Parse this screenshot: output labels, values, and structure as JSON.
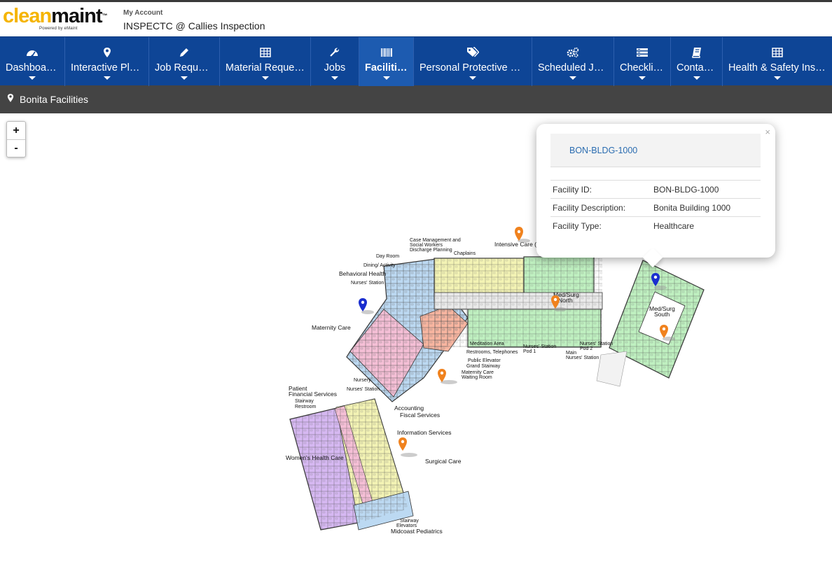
{
  "header": {
    "logo_word_a": "clean",
    "logo_word_b": "maint",
    "logo_tm": "™",
    "logo_sub": "Powered by eMaint",
    "account_label": "My Account",
    "account_name": "INSPECTC @ Callies Inspection"
  },
  "nav": {
    "items": [
      {
        "label": "Dashboards",
        "icon": "dashboard-icon"
      },
      {
        "label": "Interactive Plans",
        "icon": "map-pin-icon"
      },
      {
        "label": "Job Requests",
        "icon": "pencil-icon"
      },
      {
        "label": "Material Requests",
        "icon": "grid-icon"
      },
      {
        "label": "Jobs",
        "icon": "wrench-icon"
      },
      {
        "label": "Facilities",
        "icon": "barcode-icon",
        "active": true
      },
      {
        "label": "Personal Protective Eq...",
        "icon": "tags-icon"
      },
      {
        "label": "Scheduled Jobs",
        "icon": "gears-icon"
      },
      {
        "label": "Checklists",
        "icon": "list-icon"
      },
      {
        "label": "Contacts",
        "icon": "book-icon"
      },
      {
        "label": "Health & Safety Inspe...",
        "icon": "grid-icon"
      }
    ]
  },
  "subbar": {
    "title": "Bonita Facilities"
  },
  "zoom": {
    "in": "+",
    "out": "-"
  },
  "popup": {
    "close": "×",
    "heading": "BON-BLDG-1000",
    "rows": [
      {
        "key": "Facility ID:",
        "value": "BON-BLDG-1000"
      },
      {
        "key": "Facility Description:",
        "value": "Bonita Building 1000"
      },
      {
        "key": "Facility Type:",
        "value": "Healthcare"
      }
    ]
  },
  "plan_labels": {
    "case_mgmt_1": "Case Management and",
    "case_mgmt_2": "Social Workers",
    "case_mgmt_3": "Discharge Planning",
    "chaplains": "Chaplains",
    "intensive_care": "Intensive Care (",
    "day_room": "Day Room",
    "dining": "Dining/ Activity",
    "behavioral": "Behavioral Health",
    "nurses_station_1": "Nurses' Station",
    "maternity_care": "Maternity Care",
    "meditation": "Meditation Area",
    "restrooms": "Restrooms, Telephones",
    "public_elevator": "Public Elevator",
    "grand_stairway": "Grand Stairway",
    "maternity_wait_1": "Maternity Care",
    "maternity_wait_2": "Waiting Room",
    "nursery": "Nursery",
    "nurses_station_2": "Nurses' Station",
    "pod1_1": "Nurses' Station",
    "pod1_2": "Pod 1",
    "main_ns_1": "Main",
    "main_ns_2": "Nurses' Station",
    "pod2_1": "Nurses' Station",
    "pod2_2": "Pod 2",
    "medsurg_north_1": "Med/Surg",
    "medsurg_north_2": "North",
    "medsurg_south_1": "Med/Surg",
    "medsurg_south_2": "South",
    "patient_fin_1": "Patient",
    "patient_fin_2": "Financial Services",
    "stairway_1": "Stairway",
    "restroom": "Restroom",
    "accounting": "Accounting",
    "fiscal": "Fiscal Services",
    "info_services": "Information Services",
    "womens_health": "Women's Health Care",
    "surgical_care": "Surgical Care",
    "stairway_2": "Stairway",
    "elevators": "Elevators",
    "midcoast": "Midcoast Pediatrics"
  },
  "colors": {
    "nav_bg": "#0e4596",
    "marker_orange": "#f0821e",
    "marker_blue": "#1a2ecf",
    "zone_blue": "#bcd9f2",
    "zone_pink": "#f5bfd6",
    "zone_yellow": "#f3f3b4",
    "zone_green": "#bff0c0",
    "zone_purple": "#d6b8f2",
    "zone_salmon": "#f8b5a0"
  }
}
